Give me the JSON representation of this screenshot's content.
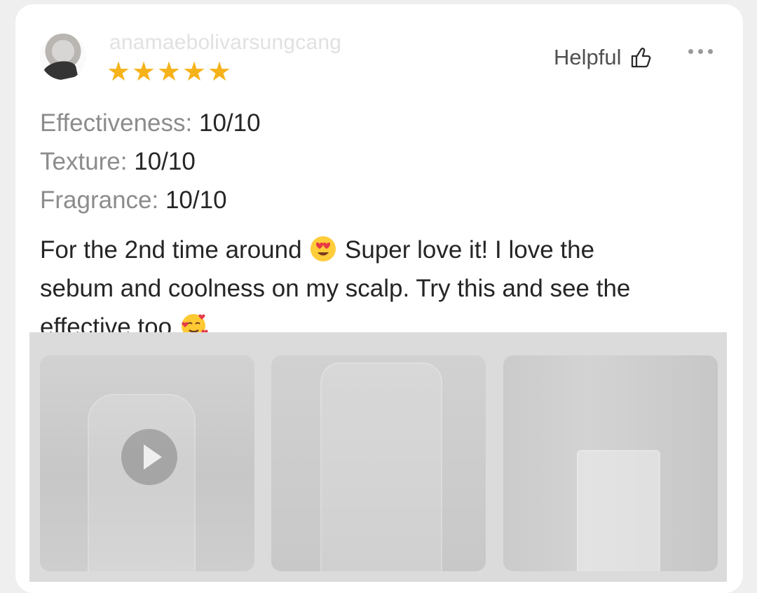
{
  "review": {
    "username": "anamaebolivarsungcang",
    "star_rating": 5,
    "stars": [
      "★",
      "★",
      "★",
      "★",
      "★"
    ],
    "helpful_label": "Helpful",
    "ratings": [
      {
        "label": "Effectiveness: ",
        "value": "10/10"
      },
      {
        "label": "Texture: ",
        "value": "10/10"
      },
      {
        "label": "Fragrance: ",
        "value": "10/10"
      }
    ],
    "text_part1": "For the 2nd time around ",
    "text_part2": " Super love it! I love the\nsebum and coolness on my scalp. Try this and see the\neffective too ",
    "emoji_1": "smiling-face-with-heart-eyes-emoji",
    "emoji_2": "smiling-face-with-hearts-emoji"
  },
  "media": {
    "items": [
      {
        "type": "video",
        "icon": "play-icon"
      },
      {
        "type": "photo"
      },
      {
        "type": "photo"
      }
    ]
  },
  "colors": {
    "star": "#f6b21a",
    "text_primary": "#262626",
    "text_secondary": "#8c8c8c",
    "username": "#e1e1e1",
    "media_overlay": "#dbdbdb"
  }
}
